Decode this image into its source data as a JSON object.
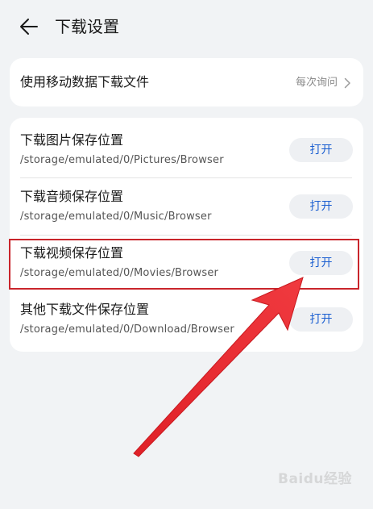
{
  "header": {
    "title": "下载设置",
    "back_icon": "arrow-left-icon"
  },
  "mobile_data": {
    "label": "使用移动数据下载文件",
    "value": "每次询问",
    "chevron_icon": "chevron-right-icon"
  },
  "locations": [
    {
      "title": "下载图片保存位置",
      "path": "/storage/emulated/0/Pictures/Browser",
      "button": "打开"
    },
    {
      "title": "下载音频保存位置",
      "path": "/storage/emulated/0/Music/Browser",
      "button": "打开"
    },
    {
      "title": "下载视频保存位置",
      "path": "/storage/emulated/0/Movies/Browser",
      "button": "打开"
    },
    {
      "title": "其他下载文件保存位置",
      "path": "/storage/emulated/0/Download/Browser",
      "button": "打开"
    }
  ],
  "annotation": {
    "highlight_color": "#c9252b",
    "arrow_color": "#e8232b"
  },
  "watermark": {
    "text": "Baidu经验"
  },
  "colors": {
    "background": "#f1f3f5",
    "card": "#ffffff",
    "button_text": "#1b5fd1",
    "button_bg": "#eef0f3"
  }
}
